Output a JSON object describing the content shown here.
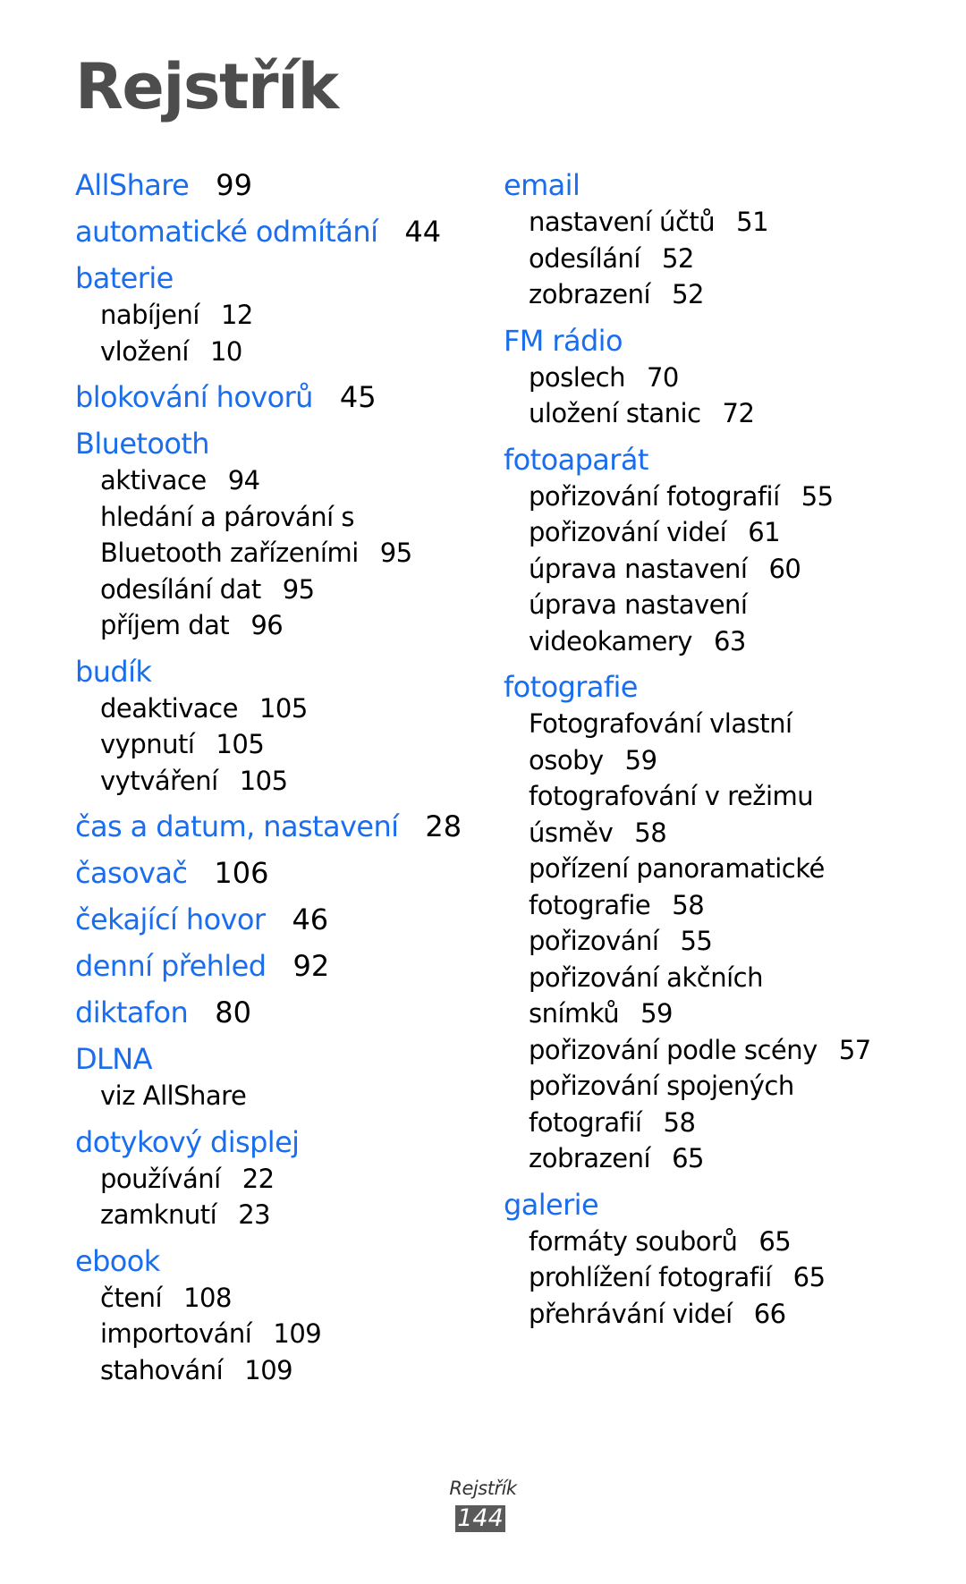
{
  "title": "Rejstřík",
  "accent_color": "#1a6eee",
  "left_column": [
    {
      "term": "AllShare",
      "page": "99",
      "subs": []
    },
    {
      "term": "automatické odmítání",
      "page": "44",
      "subs": []
    },
    {
      "term": "baterie",
      "page": "",
      "subs": [
        {
          "text": "nabíjení",
          "page": "12"
        },
        {
          "text": "vložení",
          "page": "10"
        }
      ]
    },
    {
      "term": "blokování hovorů",
      "page": "45",
      "subs": []
    },
    {
      "term": "Bluetooth",
      "page": "",
      "subs": [
        {
          "text": "aktivace",
          "page": "94"
        },
        {
          "text": "hledání a párování s",
          "page": ""
        },
        {
          "text": "Bluetooth zařízeními",
          "page": "95"
        },
        {
          "text": "odesílání dat",
          "page": "95"
        },
        {
          "text": "příjem dat",
          "page": "96"
        }
      ]
    },
    {
      "term": "budík",
      "page": "",
      "subs": [
        {
          "text": "deaktivace",
          "page": "105"
        },
        {
          "text": "vypnutí",
          "page": "105"
        },
        {
          "text": "vytváření",
          "page": "105"
        }
      ]
    },
    {
      "term": "čas a datum, nastavení",
      "page": "28",
      "subs": []
    },
    {
      "term": "časovač",
      "page": "106",
      "subs": []
    },
    {
      "term": "čekající hovor",
      "page": "46",
      "subs": []
    },
    {
      "term": "denní přehled",
      "page": "92",
      "subs": []
    },
    {
      "term": "diktafon",
      "page": "80",
      "subs": []
    },
    {
      "term": "DLNA",
      "page": "",
      "subs": [
        {
          "text": "viz AllShare",
          "page": ""
        }
      ]
    },
    {
      "term": "dotykový displej",
      "page": "",
      "subs": [
        {
          "text": "používání",
          "page": "22"
        },
        {
          "text": "zamknutí",
          "page": "23"
        }
      ]
    },
    {
      "term": "ebook",
      "page": "",
      "subs": [
        {
          "text": "čtení",
          "page": "108"
        },
        {
          "text": "importování",
          "page": "109"
        },
        {
          "text": "stahování",
          "page": "109"
        }
      ]
    }
  ],
  "right_column": [
    {
      "term": "email",
      "page": "",
      "subs": [
        {
          "text": "nastavení účtů",
          "page": "51"
        },
        {
          "text": "odesílání",
          "page": "52"
        },
        {
          "text": "zobrazení",
          "page": "52"
        }
      ]
    },
    {
      "term": "FM rádio",
      "page": "",
      "subs": [
        {
          "text": "poslech",
          "page": "70"
        },
        {
          "text": "uložení stanic",
          "page": "72"
        }
      ]
    },
    {
      "term": "fotoaparát",
      "page": "",
      "subs": [
        {
          "text": "pořizování fotografií",
          "page": "55"
        },
        {
          "text": "pořizování videí",
          "page": "61"
        },
        {
          "text": "úprava nastavení",
          "page": "60"
        },
        {
          "text": "úprava nastavení",
          "page": ""
        },
        {
          "text": "videokamery",
          "page": "63"
        }
      ]
    },
    {
      "term": "fotografie",
      "page": "",
      "subs": [
        {
          "text": "Fotografování vlastní",
          "page": ""
        },
        {
          "text": "osoby",
          "page": "59"
        },
        {
          "text": "fotografování v režimu",
          "page": ""
        },
        {
          "text": "úsměv",
          "page": "58"
        },
        {
          "text": "pořízení panoramatické",
          "page": ""
        },
        {
          "text": "fotografie",
          "page": "58"
        },
        {
          "text": "pořizování",
          "page": "55"
        },
        {
          "text": "pořizování akčních",
          "page": ""
        },
        {
          "text": "snímků",
          "page": "59"
        },
        {
          "text": "pořizování podle scény",
          "page": "57"
        },
        {
          "text": "pořizování spojených",
          "page": ""
        },
        {
          "text": "fotografií",
          "page": "58"
        },
        {
          "text": "zobrazení",
          "page": "65"
        }
      ]
    },
    {
      "term": "galerie",
      "page": "",
      "subs": [
        {
          "text": "formáty souborů",
          "page": "65"
        },
        {
          "text": "prohlížení fotografií",
          "page": "65"
        },
        {
          "text": "přehrávání videí",
          "page": "66"
        }
      ]
    }
  ],
  "footer": {
    "section_label": "Rejstřík",
    "page_number": "144"
  }
}
